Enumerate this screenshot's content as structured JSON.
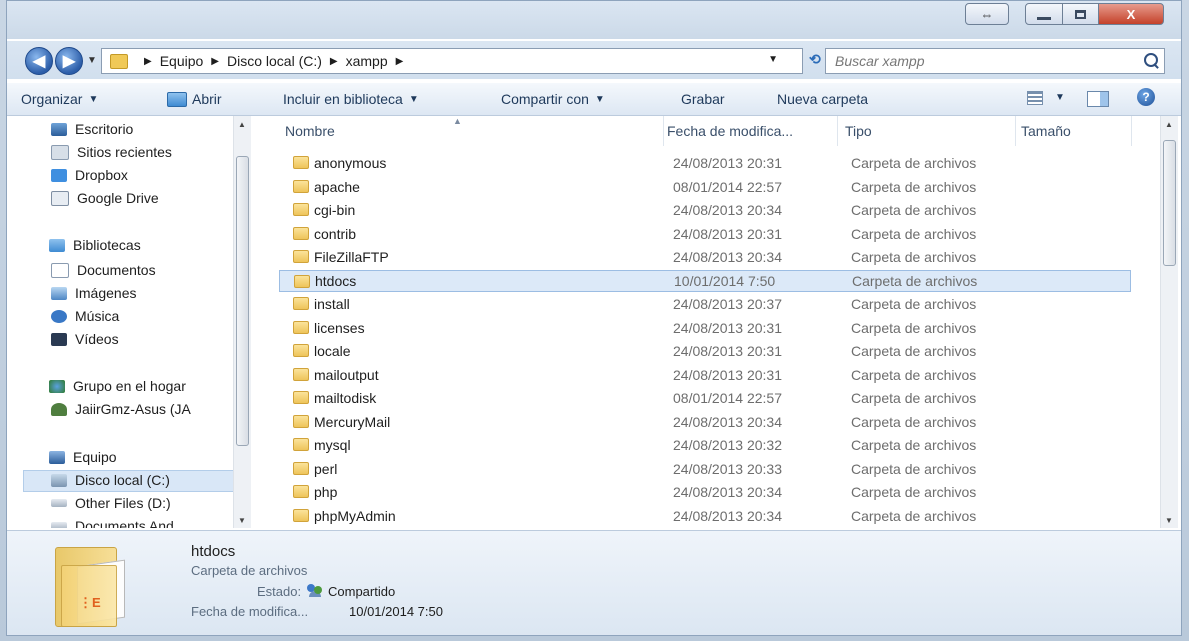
{
  "window": {
    "title_buttons": {
      "snap": "⇔",
      "close": "X"
    }
  },
  "nav": {
    "breadcrumbs": [
      "Equipo",
      "Disco local (C:)",
      "xampp"
    ],
    "search_placeholder": "Buscar xampp"
  },
  "toolbar": {
    "organize": "Organizar",
    "open": "Abrir",
    "library": "Incluir en biblioteca",
    "share": "Compartir con",
    "burn": "Grabar",
    "new_folder": "Nueva carpeta"
  },
  "sidebar": {
    "items": [
      {
        "label": "Escritorio",
        "icon": "desktop-icon"
      },
      {
        "label": "Sitios recientes",
        "icon": "recent-places-icon"
      },
      {
        "label": "Dropbox",
        "icon": "dropbox-icon"
      },
      {
        "label": "Google Drive",
        "icon": "google-drive-icon"
      },
      {
        "label": "Bibliotecas",
        "icon": "libraries-icon"
      },
      {
        "label": "Documentos",
        "icon": "documents-icon"
      },
      {
        "label": "Imágenes",
        "icon": "pictures-icon"
      },
      {
        "label": "Música",
        "icon": "music-icon"
      },
      {
        "label": "Vídeos",
        "icon": "videos-icon"
      },
      {
        "label": "Grupo en el hogar",
        "icon": "homegroup-icon"
      },
      {
        "label": "JaiirGmz-Asus (JA",
        "icon": "user-icon"
      },
      {
        "label": "Equipo",
        "icon": "computer-icon"
      },
      {
        "label": "Disco local (C:)",
        "icon": "drive-icon"
      },
      {
        "label": "Other Files (D:)",
        "icon": "drive-icon"
      },
      {
        "label": "Documents And",
        "icon": "drive-icon"
      }
    ]
  },
  "columns": {
    "name": "Nombre",
    "date": "Fecha de modifica...",
    "type": "Tipo",
    "size": "Tamaño"
  },
  "files": [
    {
      "name": "anonymous",
      "date": "24/08/2013 20:31",
      "type": "Carpeta de archivos"
    },
    {
      "name": "apache",
      "date": "08/01/2014 22:57",
      "type": "Carpeta de archivos"
    },
    {
      "name": "cgi-bin",
      "date": "24/08/2013 20:34",
      "type": "Carpeta de archivos"
    },
    {
      "name": "contrib",
      "date": "24/08/2013 20:31",
      "type": "Carpeta de archivos"
    },
    {
      "name": "FileZillaFTP",
      "date": "24/08/2013 20:34",
      "type": "Carpeta de archivos"
    },
    {
      "name": "htdocs",
      "date": "10/01/2014 7:50",
      "type": "Carpeta de archivos"
    },
    {
      "name": "install",
      "date": "24/08/2013 20:37",
      "type": "Carpeta de archivos"
    },
    {
      "name": "licenses",
      "date": "24/08/2013 20:31",
      "type": "Carpeta de archivos"
    },
    {
      "name": "locale",
      "date": "24/08/2013 20:31",
      "type": "Carpeta de archivos"
    },
    {
      "name": "mailoutput",
      "date": "24/08/2013 20:31",
      "type": "Carpeta de archivos"
    },
    {
      "name": "mailtodisk",
      "date": "08/01/2014 22:57",
      "type": "Carpeta de archivos"
    },
    {
      "name": "MercuryMail",
      "date": "24/08/2013 20:34",
      "type": "Carpeta de archivos"
    },
    {
      "name": "mysql",
      "date": "24/08/2013 20:32",
      "type": "Carpeta de archivos"
    },
    {
      "name": "perl",
      "date": "24/08/2013 20:33",
      "type": "Carpeta de archivos"
    },
    {
      "name": "php",
      "date": "24/08/2013 20:34",
      "type": "Carpeta de archivos"
    },
    {
      "name": "phpMyAdmin",
      "date": "24/08/2013 20:34",
      "type": "Carpeta de archivos"
    }
  ],
  "selected_file": "htdocs",
  "details": {
    "name": "htdocs",
    "kind": "Carpeta de archivos",
    "status_label": "Estado:",
    "status_value": "Compartido",
    "date_label": "Fecha de modifica...",
    "date_value": "10/01/2014 7:50"
  }
}
